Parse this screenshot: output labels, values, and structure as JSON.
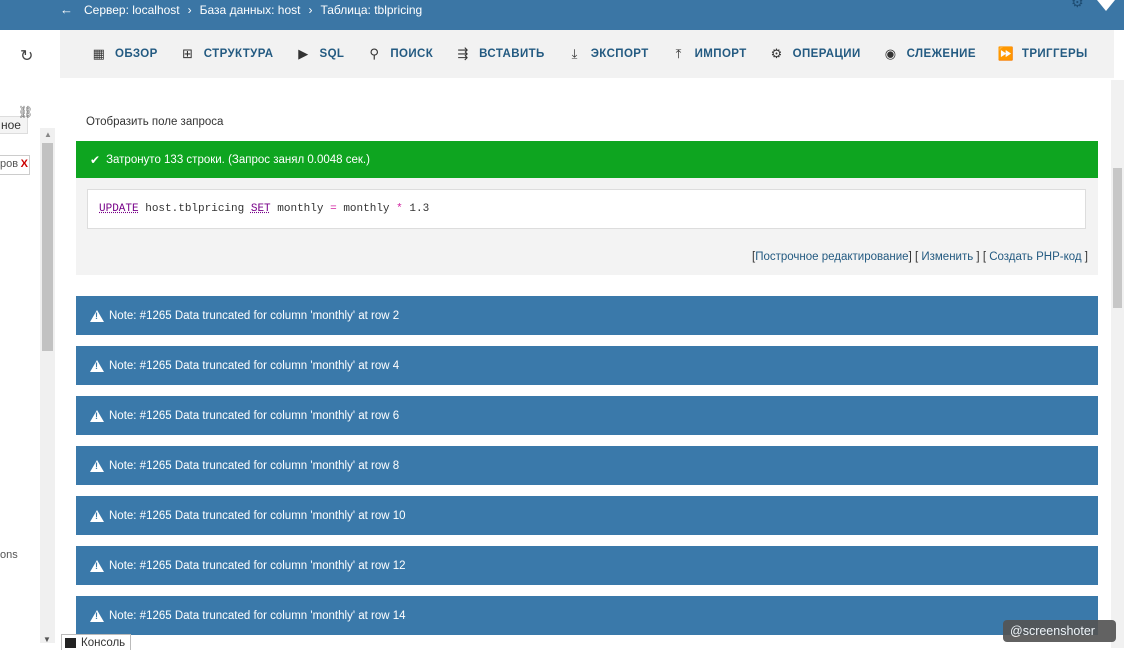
{
  "breadcrumb": {
    "back_icon": "←",
    "items": [
      {
        "label": "Сервер: localhost",
        "icon": "server-icon"
      },
      {
        "label": "База данных: host",
        "icon": "database-icon"
      },
      {
        "label": "Таблица: tblpricing",
        "icon": "table-icon"
      }
    ]
  },
  "left_panel": {
    "fragment_text": "ное",
    "filter_text": "ров",
    "filter_clear": "X",
    "bottom_fragment": "ons"
  },
  "tabs": [
    {
      "label": "Обзор",
      "icon": "browse-icon",
      "glyph": "▦"
    },
    {
      "label": "Структура",
      "icon": "structure-icon",
      "glyph": "⊞"
    },
    {
      "label": "SQL",
      "icon": "sql-icon",
      "glyph": "▶"
    },
    {
      "label": "Поиск",
      "icon": "search-icon",
      "glyph": "⚲"
    },
    {
      "label": "Вставить",
      "icon": "insert-icon",
      "glyph": "⇶"
    },
    {
      "label": "Экспорт",
      "icon": "export-icon",
      "glyph": "⤓"
    },
    {
      "label": "Импорт",
      "icon": "import-icon",
      "glyph": "⤒"
    },
    {
      "label": "Операции",
      "icon": "operations-icon",
      "glyph": "⚙"
    },
    {
      "label": "Слежение",
      "icon": "tracking-icon",
      "glyph": "◉"
    },
    {
      "label": "Триггеры",
      "icon": "triggers-icon",
      "glyph": "⏩"
    }
  ],
  "query": {
    "show_query_label": "Отобразить поле запроса",
    "success_message": "Затронуто 133 строки. (Запрос занял 0.0048 сек.)",
    "sql_parts": {
      "kw_update": "UPDATE",
      "table": "host.tblpricing",
      "kw_set": "SET",
      "col": "monthly",
      "eq": "=",
      "col2": "monthly",
      "mul": "*",
      "num": "1.3"
    },
    "links": {
      "inline_edit": "Построчное редактирование",
      "edit": "Изменить",
      "php": "Создать PHP-код"
    }
  },
  "notes": [
    "Note: #1265 Data truncated for column 'monthly' at row 2",
    "Note: #1265 Data truncated for column 'monthly' at row 4",
    "Note: #1265 Data truncated for column 'monthly' at row 6",
    "Note: #1265 Data truncated for column 'monthly' at row 8",
    "Note: #1265 Data truncated for column 'monthly' at row 10",
    "Note: #1265 Data truncated for column 'monthly' at row 12",
    "Note: #1265 Data truncated for column 'monthly' at row 14"
  ],
  "console_label": "Консоль",
  "watermark": "@screenshoter",
  "colors": {
    "header_blue": "#3b76a5",
    "success_green": "#0ea520",
    "note_blue": "#3a79aa",
    "link_blue": "#235a81"
  }
}
